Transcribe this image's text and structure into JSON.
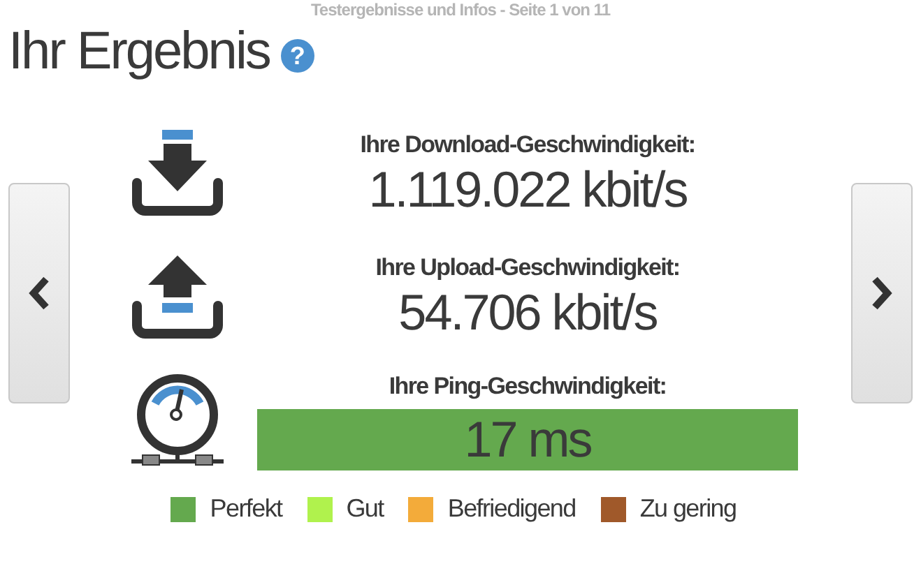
{
  "page_caption": "Testergebnisse und Infos - Seite 1 von 11",
  "title": "Ihr Ergebnis",
  "help_icon": "?",
  "results": [
    {
      "kind": "download",
      "label": "Ihre Download-Geschwindigkeit:",
      "value": "1.119.022 kbit/s"
    },
    {
      "kind": "upload",
      "label": "Ihre Upload-Geschwindigkeit:",
      "value": "54.706 kbit/s"
    },
    {
      "kind": "ping",
      "label": "Ihre Ping-Geschwindigkeit:",
      "value": "17 ms",
      "color": "#64a94e"
    }
  ],
  "legend": [
    {
      "label": "Perfekt",
      "color": "#64a94e"
    },
    {
      "label": "Gut",
      "color": "#b0f24d"
    },
    {
      "label": "Befriedigend",
      "color": "#f3ab3a"
    },
    {
      "label": "Zu gering",
      "color": "#a0592a"
    }
  ]
}
